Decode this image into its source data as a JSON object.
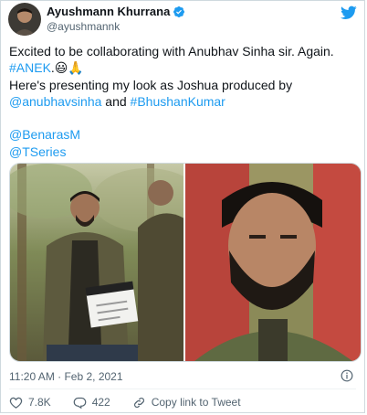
{
  "tweet": {
    "author_name": "Ayushmann Khurrana",
    "author_handle": "@ayushmannk",
    "lines": [
      {
        "parts": [
          {
            "t": "Excited to be collaborating with Anubhav Sinha sir. Again.",
            "link": false
          }
        ]
      },
      {
        "parts": [
          {
            "t": "#ANEK",
            "link": true
          },
          {
            "t": ".😃🙏",
            "link": false
          }
        ]
      },
      {
        "parts": [
          {
            "t": "Here's presenting my look as Joshua produced by",
            "link": false
          }
        ]
      },
      {
        "parts": [
          {
            "t": "@anubhavsinha",
            "link": true
          },
          {
            "t": " and ",
            "link": false
          },
          {
            "t": "#BhushanKumar",
            "link": true
          }
        ]
      },
      {
        "parts": [
          {
            "t": "",
            "link": false
          }
        ]
      },
      {
        "parts": [
          {
            "t": "@BenarasM",
            "link": true
          }
        ]
      },
      {
        "parts": [
          {
            "t": "@TSeries",
            "link": true
          }
        ]
      }
    ],
    "timestamp": "11:20 AM · Feb 2, 2021",
    "likes": "7.8K",
    "replies": "422",
    "share_label": "Copy link to Tweet"
  },
  "colors": {
    "link": "#1d9bf0",
    "verified": "#1d9bf0",
    "muted": "#536471"
  },
  "icons": {
    "verified": "verified-badge-icon",
    "logo": "twitter-bird-icon",
    "info": "info-icon",
    "like": "heart-icon",
    "reply": "reply-icon",
    "share": "link-icon"
  }
}
